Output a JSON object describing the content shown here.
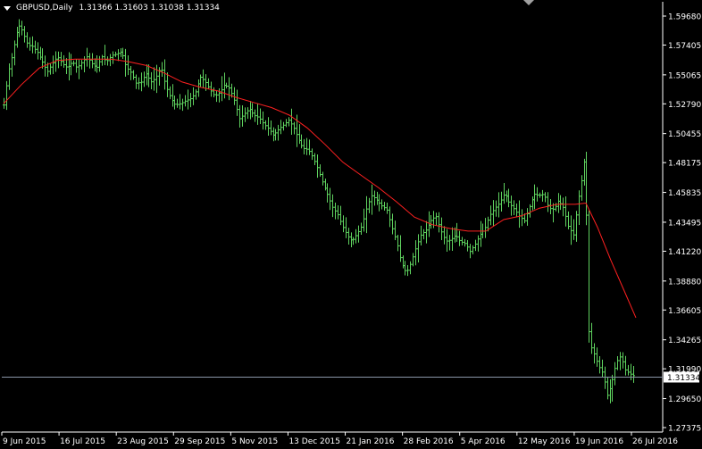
{
  "header": {
    "symbol_timeframe": "GBPUSD,Daily",
    "ohlc": "1.31366 1.31603 1.31038 1.31334"
  },
  "current_price_label": "1.31334",
  "colors": {
    "background": "#000000",
    "bars": "#5fd35f",
    "moving_average": "#ff2020",
    "price_line": "#8a96a8",
    "axis": "#ffffff"
  },
  "chart_data": {
    "type": "ohlc",
    "symbol": "GBPUSD",
    "timeframe": "Daily",
    "y_ticks": [
      "1.59680",
      "1.57405",
      "1.55065",
      "1.52790",
      "1.50455",
      "1.48175",
      "1.45835",
      "1.43495",
      "1.41220",
      "1.38880",
      "1.36605",
      "1.34265",
      "1.31990",
      "1.29650",
      "1.27375"
    ],
    "ylim": [
      1.27375,
      1.5968
    ],
    "x_ticks": [
      "9 Jun 2015",
      "16 Jul 2015",
      "23 Aug 2015",
      "29 Sep 2015",
      "5 Nov 2015",
      "13 Dec 2015",
      "21 Jan 2016",
      "28 Feb 2016",
      "5 Apr 2016",
      "12 May 2016",
      "19 Jun 2016",
      "26 Jul 2016"
    ],
    "current_price": 1.31334,
    "close_path": [
      [
        0,
        1.527
      ],
      [
        5,
        1.553
      ],
      [
        9,
        1.565
      ],
      [
        14,
        1.583
      ],
      [
        18,
        1.59
      ],
      [
        22,
        1.583
      ],
      [
        27,
        1.574
      ],
      [
        32,
        1.573
      ],
      [
        38,
        1.568
      ],
      [
        44,
        1.56
      ],
      [
        49,
        1.553
      ],
      [
        55,
        1.56
      ],
      [
        60,
        1.565
      ],
      [
        66,
        1.559
      ],
      [
        71,
        1.556
      ],
      [
        77,
        1.561
      ],
      [
        82,
        1.556
      ],
      [
        88,
        1.561
      ],
      [
        93,
        1.565
      ],
      [
        99,
        1.559
      ],
      [
        104,
        1.556
      ],
      [
        110,
        1.565
      ],
      [
        115,
        1.561
      ],
      [
        121,
        1.566
      ],
      [
        126,
        1.567
      ],
      [
        132,
        1.569
      ],
      [
        137,
        1.557
      ],
      [
        143,
        1.552
      ],
      [
        148,
        1.544
      ],
      [
        154,
        1.545
      ],
      [
        159,
        1.552
      ],
      [
        165,
        1.545
      ],
      [
        170,
        1.548
      ],
      [
        176,
        1.557
      ],
      [
        181,
        1.542
      ],
      [
        187,
        1.532
      ],
      [
        192,
        1.527
      ],
      [
        198,
        1.528
      ],
      [
        203,
        1.53
      ],
      [
        209,
        1.532
      ],
      [
        214,
        1.536
      ],
      [
        220,
        1.549
      ],
      [
        225,
        1.546
      ],
      [
        231,
        1.539
      ],
      [
        236,
        1.534
      ],
      [
        242,
        1.537
      ],
      [
        247,
        1.543
      ],
      [
        253,
        1.54
      ],
      [
        258,
        1.531
      ],
      [
        264,
        1.516
      ],
      [
        269,
        1.52
      ],
      [
        275,
        1.524
      ],
      [
        280,
        1.519
      ],
      [
        286,
        1.517
      ],
      [
        291,
        1.512
      ],
      [
        297,
        1.508
      ],
      [
        302,
        1.503
      ],
      [
        308,
        1.508
      ],
      [
        313,
        1.511
      ],
      [
        319,
        1.515
      ],
      [
        324,
        1.51
      ],
      [
        330,
        1.5
      ],
      [
        335,
        1.493
      ],
      [
        341,
        1.492
      ],
      [
        346,
        1.486
      ],
      [
        352,
        1.476
      ],
      [
        357,
        1.466
      ],
      [
        363,
        1.456
      ],
      [
        368,
        1.447
      ],
      [
        374,
        1.441
      ],
      [
        379,
        1.432
      ],
      [
        385,
        1.424
      ],
      [
        390,
        1.42
      ],
      [
        396,
        1.426
      ],
      [
        401,
        1.432
      ],
      [
        407,
        1.448
      ],
      [
        412,
        1.456
      ],
      [
        418,
        1.452
      ],
      [
        423,
        1.448
      ],
      [
        429,
        1.445
      ],
      [
        434,
        1.432
      ],
      [
        440,
        1.419
      ],
      [
        445,
        1.403
      ],
      [
        451,
        1.395
      ],
      [
        456,
        1.403
      ],
      [
        462,
        1.416
      ],
      [
        467,
        1.425
      ],
      [
        473,
        1.429
      ],
      [
        478,
        1.436
      ],
      [
        484,
        1.44
      ],
      [
        489,
        1.429
      ],
      [
        495,
        1.42
      ],
      [
        500,
        1.421
      ],
      [
        506,
        1.425
      ],
      [
        511,
        1.42
      ],
      [
        517,
        1.418
      ],
      [
        522,
        1.412
      ],
      [
        528,
        1.418
      ],
      [
        533,
        1.425
      ],
      [
        539,
        1.43
      ],
      [
        544,
        1.44
      ],
      [
        550,
        1.446
      ],
      [
        555,
        1.45
      ],
      [
        561,
        1.458
      ],
      [
        566,
        1.45
      ],
      [
        572,
        1.445
      ],
      [
        577,
        1.44
      ],
      [
        583,
        1.436
      ],
      [
        588,
        1.446
      ],
      [
        594,
        1.457
      ],
      [
        599,
        1.456
      ],
      [
        605,
        1.457
      ],
      [
        610,
        1.446
      ],
      [
        616,
        1.445
      ],
      [
        621,
        1.452
      ],
      [
        627,
        1.446
      ],
      [
        632,
        1.432
      ],
      [
        638,
        1.425
      ],
      [
        643,
        1.452
      ],
      [
        648,
        1.473
      ],
      [
        652,
        1.496
      ],
      [
        653,
        1.385
      ],
      [
        656,
        1.34
      ],
      [
        661,
        1.332
      ],
      [
        666,
        1.322
      ],
      [
        671,
        1.316
      ],
      [
        676,
        1.298
      ],
      [
        681,
        1.31
      ],
      [
        686,
        1.325
      ],
      [
        691,
        1.33
      ],
      [
        696,
        1.319
      ],
      [
        701,
        1.316
      ],
      [
        706,
        1.314
      ],
      [
        709,
        1.313
      ]
    ],
    "ma_path": [
      [
        0,
        1.528
      ],
      [
        20,
        1.543
      ],
      [
        40,
        1.556
      ],
      [
        60,
        1.562
      ],
      [
        80,
        1.563
      ],
      [
        100,
        1.563
      ],
      [
        120,
        1.563
      ],
      [
        140,
        1.561
      ],
      [
        160,
        1.558
      ],
      [
        180,
        1.552
      ],
      [
        200,
        1.545
      ],
      [
        220,
        1.541
      ],
      [
        240,
        1.538
      ],
      [
        260,
        1.533
      ],
      [
        280,
        1.529
      ],
      [
        300,
        1.525
      ],
      [
        320,
        1.519
      ],
      [
        340,
        1.509
      ],
      [
        360,
        1.496
      ],
      [
        380,
        1.482
      ],
      [
        400,
        1.472
      ],
      [
        420,
        1.462
      ],
      [
        440,
        1.451
      ],
      [
        460,
        1.439
      ],
      [
        480,
        1.433
      ],
      [
        500,
        1.43
      ],
      [
        520,
        1.428
      ],
      [
        540,
        1.428
      ],
      [
        560,
        1.437
      ],
      [
        580,
        1.44
      ],
      [
        600,
        1.446
      ],
      [
        620,
        1.449
      ],
      [
        640,
        1.449
      ],
      [
        652,
        1.45
      ],
      [
        665,
        1.431
      ],
      [
        680,
        1.405
      ],
      [
        695,
        1.381
      ],
      [
        708,
        1.36
      ]
    ]
  }
}
